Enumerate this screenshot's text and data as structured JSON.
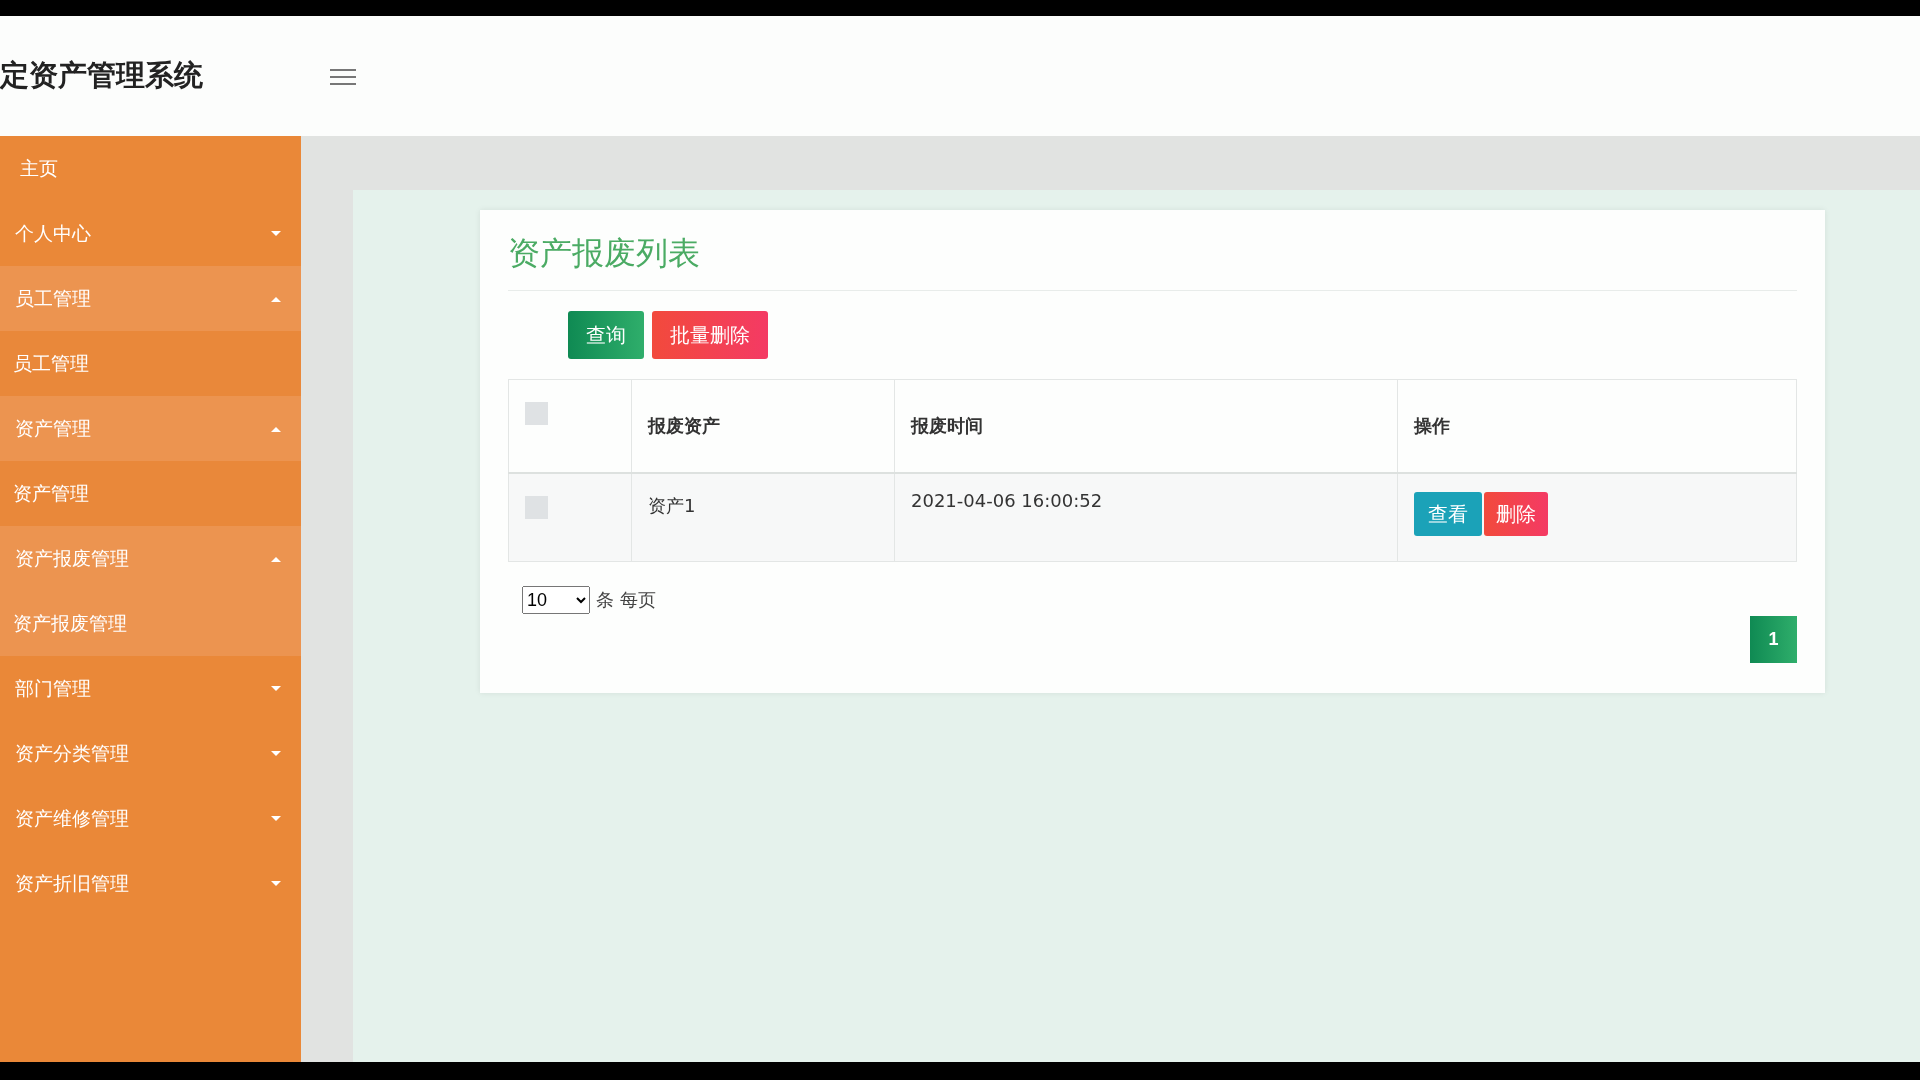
{
  "header": {
    "title": "定资产管理系统"
  },
  "sidebar": {
    "items": [
      {
        "label": "主页",
        "kind": "link"
      },
      {
        "label": "个人中心",
        "kind": "group",
        "expanded": false
      },
      {
        "label": "员工管理",
        "kind": "group",
        "expanded": true,
        "children": [
          {
            "label": "员工管理",
            "selected": false
          }
        ]
      },
      {
        "label": "资产管理",
        "kind": "group",
        "expanded": true,
        "children": [
          {
            "label": "资产管理",
            "selected": false
          }
        ]
      },
      {
        "label": "资产报废管理",
        "kind": "group",
        "expanded": true,
        "children": [
          {
            "label": "资产报废管理",
            "selected": true
          }
        ]
      },
      {
        "label": "部门管理",
        "kind": "group",
        "expanded": false
      },
      {
        "label": "资产分类管理",
        "kind": "group",
        "expanded": false
      },
      {
        "label": "资产维修管理",
        "kind": "group",
        "expanded": false
      },
      {
        "label": "资产折旧管理",
        "kind": "group",
        "expanded": false
      }
    ]
  },
  "card": {
    "title": "资产报废列表",
    "buttons": [
      {
        "label": "查询",
        "kind": "search"
      },
      {
        "label": "批量删除",
        "kind": "delete"
      }
    ],
    "table": {
      "select_all": {
        "checked": false
      },
      "columns": [
        "报废资产",
        "报废时间",
        "操作"
      ],
      "rows": [
        {
          "checked": false,
          "cells": [
            "资产1",
            "2021-04-06 16:00:52"
          ],
          "actions": [
            {
              "label": "查看",
              "kind": "view"
            },
            {
              "label": "删除",
              "kind": "delete"
            }
          ]
        }
      ]
    },
    "pagination": {
      "page_size": "10",
      "per_page_label": "条 每页",
      "pages": [
        {
          "label": "1",
          "selected": true
        }
      ]
    }
  }
}
